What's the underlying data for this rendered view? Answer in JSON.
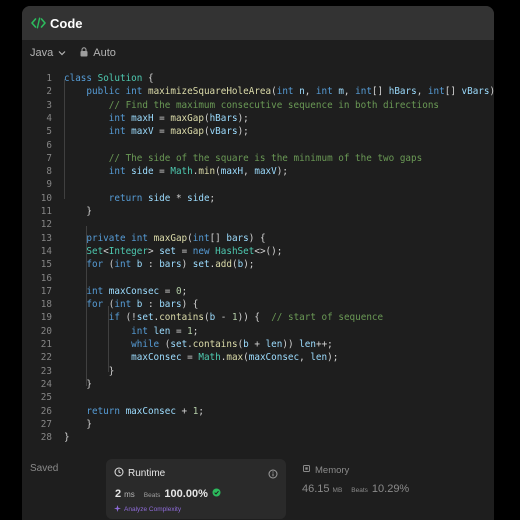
{
  "header": {
    "title": "Code"
  },
  "toolbar": {
    "language": "Java",
    "auto_label": "Auto"
  },
  "colors": {
    "keyword": "#569cd6",
    "comment": "#6a9955",
    "type": "#4ec9b0",
    "function": "#dcdcaa",
    "variable": "#9cdcfe",
    "number": "#b5cea8",
    "text": "#d4d4d4",
    "line_number": "#858585",
    "accent_green": "#2cbb5d",
    "accent_purple": "#8e6bd8"
  },
  "code": {
    "lines": [
      {
        "n": "1",
        "t": [
          [
            "k",
            "class "
          ],
          [
            "t",
            "Solution"
          ],
          [
            "p",
            " {"
          ]
        ]
      },
      {
        "n": "2",
        "t": [
          [
            "p",
            "    "
          ],
          [
            "k",
            "public int "
          ],
          [
            "f",
            "maximizeSquareHoleArea"
          ],
          [
            "p",
            "("
          ],
          [
            "k",
            "int "
          ],
          [
            "v",
            "n"
          ],
          [
            "p",
            ", "
          ],
          [
            "k",
            "int "
          ],
          [
            "v",
            "m"
          ],
          [
            "p",
            ", "
          ],
          [
            "k",
            "int"
          ],
          [
            "p",
            "[] "
          ],
          [
            "v",
            "hBars"
          ],
          [
            "p",
            ", "
          ],
          [
            "k",
            "int"
          ],
          [
            "p",
            "[] "
          ],
          [
            "v",
            "vBars"
          ],
          [
            "p",
            ") {"
          ]
        ]
      },
      {
        "n": "3",
        "t": [
          [
            "p",
            "        "
          ],
          [
            "c",
            "// Find the maximum consecutive sequence in both directions"
          ]
        ]
      },
      {
        "n": "4",
        "t": [
          [
            "p",
            "        "
          ],
          [
            "k",
            "int "
          ],
          [
            "v",
            "maxH"
          ],
          [
            "p",
            " = "
          ],
          [
            "f",
            "maxGap"
          ],
          [
            "p",
            "("
          ],
          [
            "v",
            "hBars"
          ],
          [
            "p",
            ");"
          ]
        ]
      },
      {
        "n": "5",
        "t": [
          [
            "p",
            "        "
          ],
          [
            "k",
            "int "
          ],
          [
            "v",
            "maxV"
          ],
          [
            "p",
            " = "
          ],
          [
            "f",
            "maxGap"
          ],
          [
            "p",
            "("
          ],
          [
            "v",
            "vBars"
          ],
          [
            "p",
            ");"
          ]
        ]
      },
      {
        "n": "6",
        "t": []
      },
      {
        "n": "7",
        "t": [
          [
            "p",
            "        "
          ],
          [
            "c",
            "// The side of the square is the minimum of the two gaps"
          ]
        ]
      },
      {
        "n": "8",
        "t": [
          [
            "p",
            "        "
          ],
          [
            "k",
            "int "
          ],
          [
            "v",
            "side"
          ],
          [
            "p",
            " = "
          ],
          [
            "t",
            "Math"
          ],
          [
            "p",
            "."
          ],
          [
            "f",
            "min"
          ],
          [
            "p",
            "("
          ],
          [
            "v",
            "maxH"
          ],
          [
            "p",
            ", "
          ],
          [
            "v",
            "maxV"
          ],
          [
            "p",
            ");"
          ]
        ]
      },
      {
        "n": "9",
        "t": []
      },
      {
        "n": "10",
        "t": [
          [
            "p",
            "        "
          ],
          [
            "k",
            "return "
          ],
          [
            "v",
            "side"
          ],
          [
            "p",
            " * "
          ],
          [
            "v",
            "side"
          ],
          [
            "p",
            ";"
          ]
        ]
      },
      {
        "n": "11",
        "t": [
          [
            "p",
            "    }"
          ]
        ]
      },
      {
        "n": "12",
        "t": []
      },
      {
        "n": "13",
        "t": [
          [
            "p",
            "    "
          ],
          [
            "k",
            "private int "
          ],
          [
            "f",
            "maxGap"
          ],
          [
            "p",
            "("
          ],
          [
            "k",
            "int"
          ],
          [
            "p",
            "[] "
          ],
          [
            "v",
            "bars"
          ],
          [
            "p",
            ") {"
          ]
        ]
      },
      {
        "n": "14",
        "t": [
          [
            "p",
            "    "
          ],
          [
            "t",
            "Set"
          ],
          [
            "p",
            "<"
          ],
          [
            "t",
            "Integer"
          ],
          [
            "p",
            "> "
          ],
          [
            "v",
            "set"
          ],
          [
            "p",
            " = "
          ],
          [
            "k",
            "new "
          ],
          [
            "t",
            "HashSet"
          ],
          [
            "p",
            "<>();"
          ]
        ]
      },
      {
        "n": "15",
        "t": [
          [
            "p",
            "    "
          ],
          [
            "k",
            "for "
          ],
          [
            "p",
            "("
          ],
          [
            "k",
            "int "
          ],
          [
            "v",
            "b"
          ],
          [
            "p",
            " : "
          ],
          [
            "v",
            "bars"
          ],
          [
            "p",
            ") "
          ],
          [
            "v",
            "set"
          ],
          [
            "p",
            "."
          ],
          [
            "f",
            "add"
          ],
          [
            "p",
            "("
          ],
          [
            "v",
            "b"
          ],
          [
            "p",
            ");"
          ]
        ]
      },
      {
        "n": "16",
        "t": []
      },
      {
        "n": "17",
        "t": [
          [
            "p",
            "    "
          ],
          [
            "k",
            "int "
          ],
          [
            "v",
            "maxConsec"
          ],
          [
            "p",
            " = "
          ],
          [
            "n",
            "0"
          ],
          [
            "p",
            ";"
          ]
        ]
      },
      {
        "n": "18",
        "t": [
          [
            "p",
            "    "
          ],
          [
            "k",
            "for "
          ],
          [
            "p",
            "("
          ],
          [
            "k",
            "int "
          ],
          [
            "v",
            "b"
          ],
          [
            "p",
            " : "
          ],
          [
            "v",
            "bars"
          ],
          [
            "p",
            ") {"
          ]
        ]
      },
      {
        "n": "19",
        "t": [
          [
            "p",
            "        "
          ],
          [
            "k",
            "if "
          ],
          [
            "p",
            "(!"
          ],
          [
            "v",
            "set"
          ],
          [
            "p",
            "."
          ],
          [
            "f",
            "contains"
          ],
          [
            "p",
            "("
          ],
          [
            "v",
            "b"
          ],
          [
            "p",
            " - "
          ],
          [
            "n",
            "1"
          ],
          [
            "p",
            ")) {  "
          ],
          [
            "c",
            "// start of sequence"
          ]
        ]
      },
      {
        "n": "20",
        "t": [
          [
            "p",
            "            "
          ],
          [
            "k",
            "int "
          ],
          [
            "v",
            "len"
          ],
          [
            "p",
            " = "
          ],
          [
            "n",
            "1"
          ],
          [
            "p",
            ";"
          ]
        ]
      },
      {
        "n": "21",
        "t": [
          [
            "p",
            "            "
          ],
          [
            "k",
            "while "
          ],
          [
            "p",
            "("
          ],
          [
            "v",
            "set"
          ],
          [
            "p",
            "."
          ],
          [
            "f",
            "contains"
          ],
          [
            "p",
            "("
          ],
          [
            "v",
            "b"
          ],
          [
            "p",
            " + "
          ],
          [
            "v",
            "len"
          ],
          [
            "p",
            ")) "
          ],
          [
            "v",
            "len"
          ],
          [
            "p",
            "++;"
          ]
        ]
      },
      {
        "n": "22",
        "t": [
          [
            "p",
            "            "
          ],
          [
            "v",
            "maxConsec"
          ],
          [
            "p",
            " = "
          ],
          [
            "t",
            "Math"
          ],
          [
            "p",
            "."
          ],
          [
            "f",
            "max"
          ],
          [
            "p",
            "("
          ],
          [
            "v",
            "maxConsec"
          ],
          [
            "p",
            ", "
          ],
          [
            "v",
            "len"
          ],
          [
            "p",
            ");"
          ]
        ]
      },
      {
        "n": "23",
        "t": [
          [
            "p",
            "        }"
          ]
        ]
      },
      {
        "n": "24",
        "t": [
          [
            "p",
            "    }"
          ]
        ]
      },
      {
        "n": "25",
        "t": []
      },
      {
        "n": "26",
        "t": [
          [
            "p",
            "    "
          ],
          [
            "k",
            "return "
          ],
          [
            "v",
            "maxConsec"
          ],
          [
            "p",
            " + "
          ],
          [
            "n",
            "1"
          ],
          [
            "p",
            ";"
          ]
        ]
      },
      {
        "n": "27",
        "t": [
          [
            "p",
            "    }"
          ]
        ]
      },
      {
        "n": "28",
        "t": [
          [
            "p",
            "}"
          ]
        ]
      }
    ]
  },
  "status": {
    "saved_label": "Saved"
  },
  "runtime": {
    "title": "Runtime",
    "value": "2",
    "unit": "ms",
    "beats_label": "Beats",
    "percent": "100.00%",
    "analyze_label": "Analyze Complexity"
  },
  "memory": {
    "title": "Memory",
    "value": "46.15",
    "unit": "MB",
    "beats_label": "Beats",
    "percent": "10.29%"
  }
}
